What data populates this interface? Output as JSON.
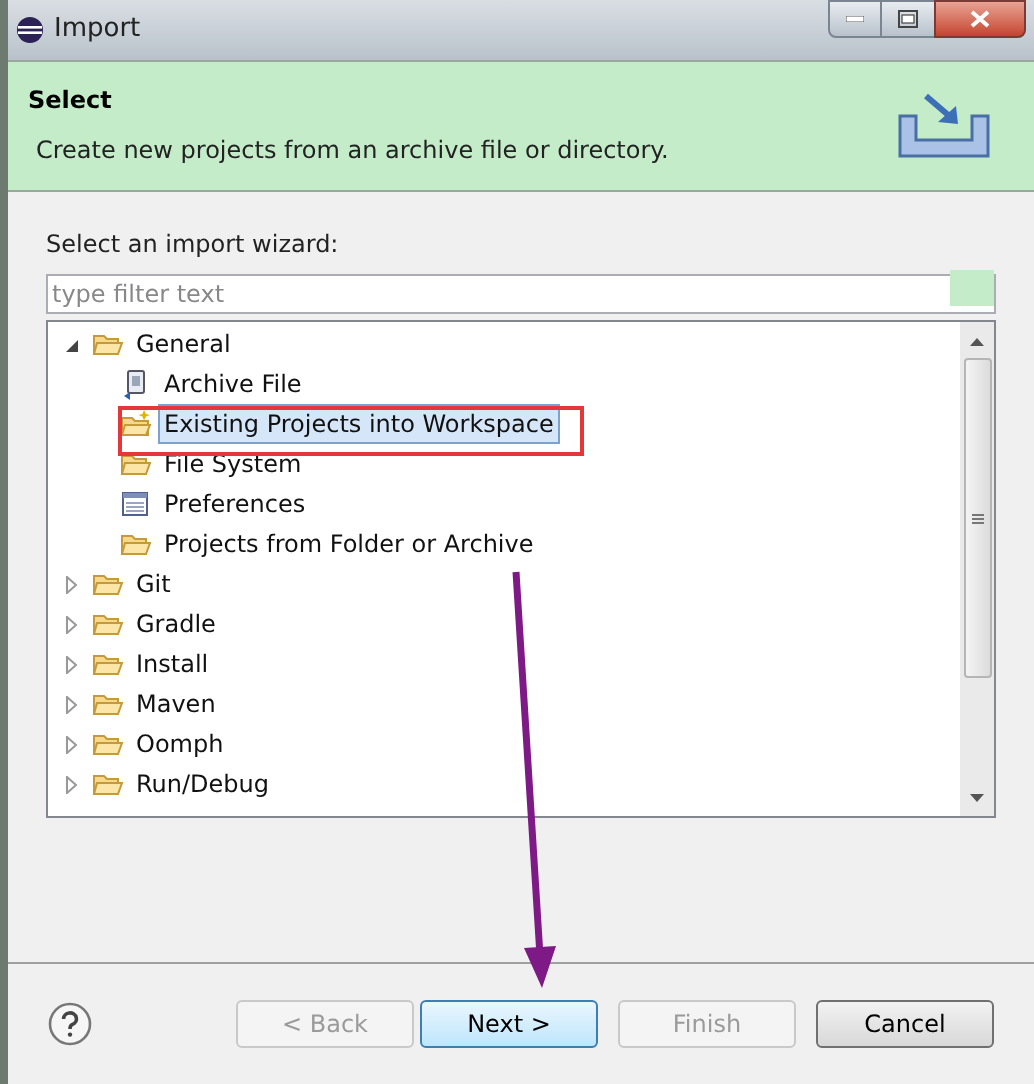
{
  "window": {
    "title": "Import"
  },
  "header": {
    "title": "Select",
    "description": "Create new projects from an archive file or directory."
  },
  "wizard_label": "Select an import wizard:",
  "filter": {
    "placeholder": "type filter text"
  },
  "tree": [
    {
      "label": "General",
      "kind": "folder",
      "expanded": true,
      "selected": false,
      "children": [
        {
          "label": "Archive File",
          "kind": "archive",
          "selected": false
        },
        {
          "label": "Existing Projects into Workspace",
          "kind": "project",
          "selected": true
        },
        {
          "label": "File System",
          "kind": "folder",
          "selected": false
        },
        {
          "label": "Preferences",
          "kind": "preferences",
          "selected": false
        },
        {
          "label": "Projects from Folder or Archive",
          "kind": "folder",
          "selected": false
        }
      ]
    },
    {
      "label": "Git",
      "kind": "folder",
      "expanded": false,
      "selected": false
    },
    {
      "label": "Gradle",
      "kind": "folder",
      "expanded": false,
      "selected": false
    },
    {
      "label": "Install",
      "kind": "folder",
      "expanded": false,
      "selected": false
    },
    {
      "label": "Maven",
      "kind": "folder",
      "expanded": false,
      "selected": false
    },
    {
      "label": "Oomph",
      "kind": "folder",
      "expanded": false,
      "selected": false
    },
    {
      "label": "Run/Debug",
      "kind": "folder",
      "expanded": false,
      "selected": false
    }
  ],
  "buttons": [
    {
      "label": "< Back",
      "disabled": true,
      "default": false
    },
    {
      "label": "Next >",
      "disabled": false,
      "default": true
    },
    {
      "label": "Finish",
      "disabled": true,
      "default": false
    },
    {
      "label": "Cancel",
      "disabled": false,
      "default": false
    }
  ]
}
